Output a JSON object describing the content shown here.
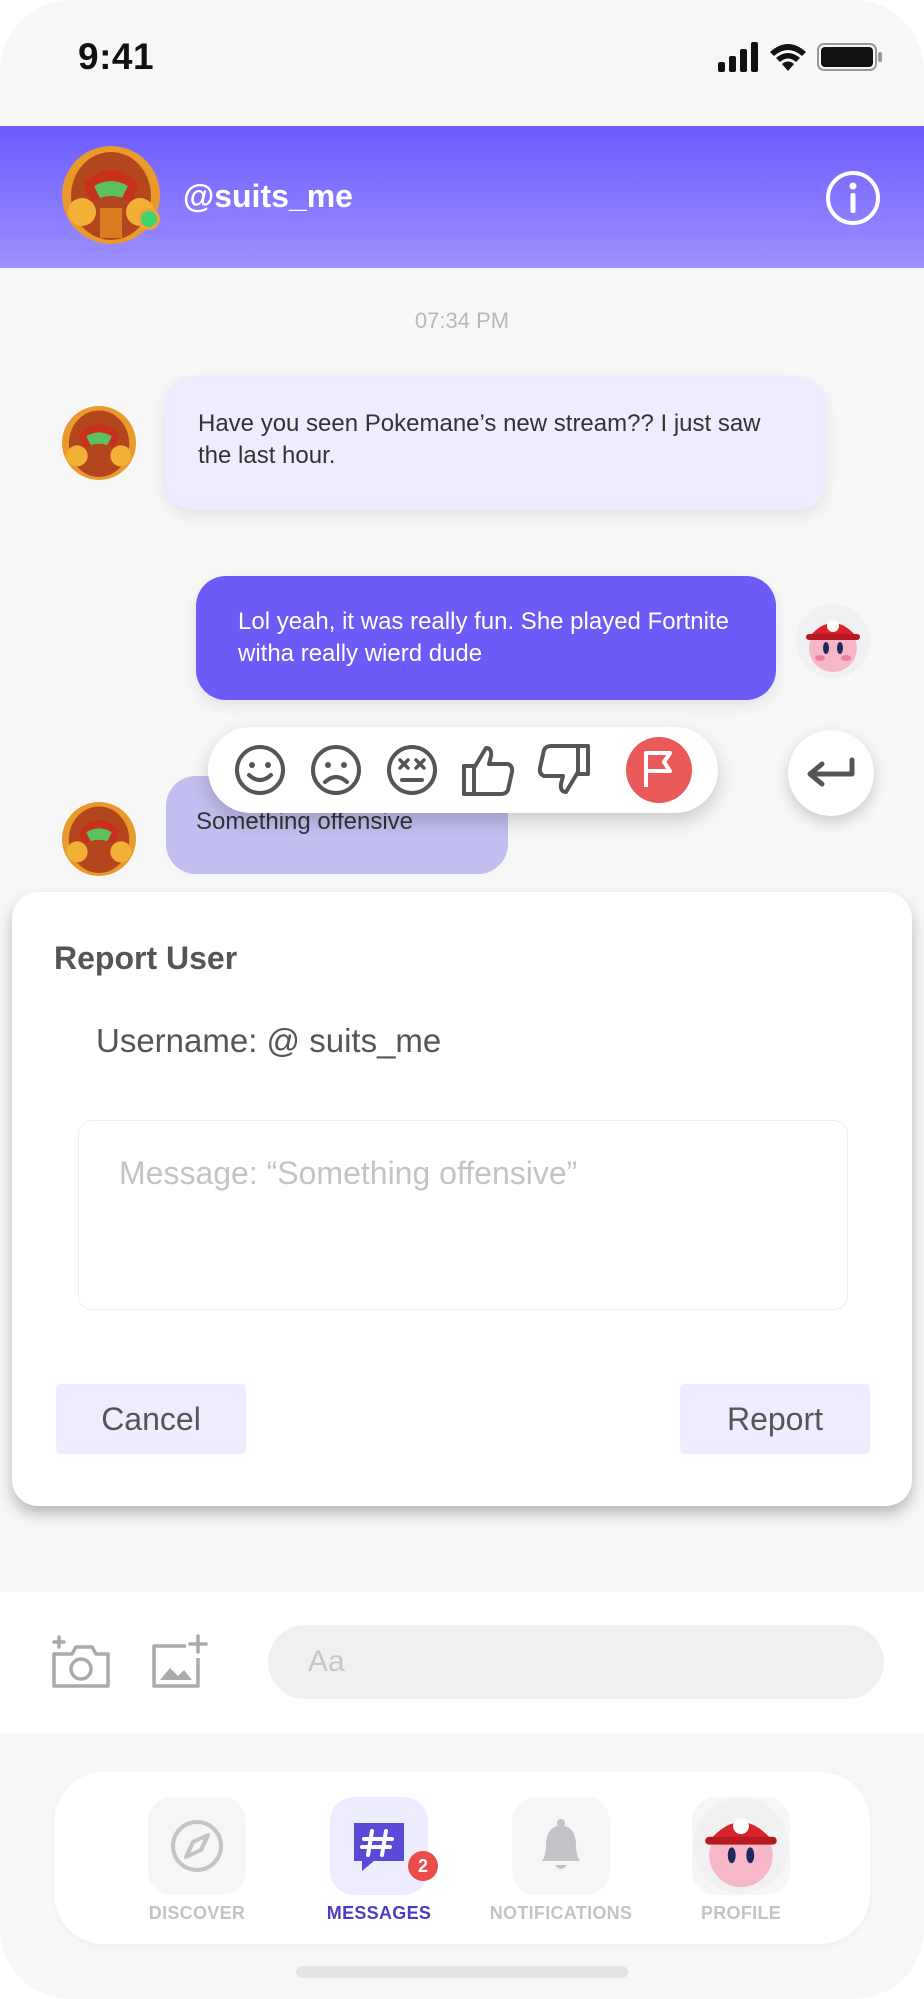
{
  "status_bar": {
    "time": "9:41"
  },
  "header": {
    "username": "@suits_me"
  },
  "chat": {
    "timestamp": "07:34 PM",
    "messages": [
      {
        "from": "them",
        "text": "Have you seen Pokemane’s new stream?? I just saw the last hour."
      },
      {
        "from": "me",
        "text": "Lol yeah, it was really fun. She played Fortnite witha really wierd dude"
      },
      {
        "from": "them",
        "text": "Something offensive"
      }
    ]
  },
  "reactions": [
    "smile-icon",
    "frown-icon",
    "dizzy-face-icon",
    "thumbs-up-icon",
    "thumbs-down-icon",
    "flag-icon"
  ],
  "report_modal": {
    "title": "Report User",
    "username_line": "Username: @ suits_me",
    "message_placeholder": "Message: “Something offensive”",
    "cancel_label": "Cancel",
    "report_label": "Report"
  },
  "composer": {
    "placeholder": "Aa"
  },
  "tabbar": {
    "tabs": [
      {
        "label": "DISCOVER",
        "active": false
      },
      {
        "label": "MESSAGES",
        "active": true,
        "badge": "2"
      },
      {
        "label": "NOTIFICATIONS",
        "active": false
      },
      {
        "label": "PROFILE",
        "active": false
      }
    ]
  },
  "colors": {
    "accent": "#6c5bf6",
    "flag": "#ea5a5a",
    "badge": "#ea4b4b",
    "bubble_in": "#eeecff"
  }
}
